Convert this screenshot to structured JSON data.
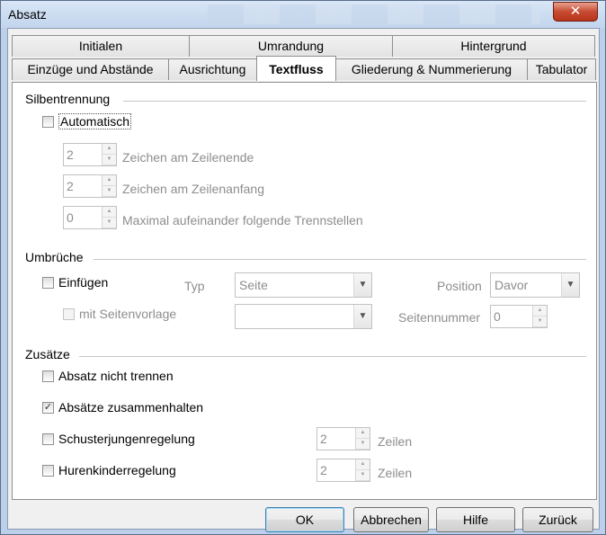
{
  "window": {
    "title": "Absatz",
    "close_glyph": "✕"
  },
  "tabs": {
    "row_top": [
      "Initialen",
      "Umrandung",
      "Hintergrund"
    ],
    "row_bottom": [
      "Einzüge und Abstände",
      "Ausrichtung",
      "Textfluss",
      "Gliederung & Nummerierung",
      "Tabulator"
    ],
    "active": "Textfluss"
  },
  "hyphenation": {
    "heading": "Silbentrennung",
    "automatic_label": "Automatisch",
    "automatic_checked": false,
    "chars_end_value": "2",
    "chars_end_label": "Zeichen am Zeilenende",
    "chars_start_value": "2",
    "chars_start_label": "Zeichen am Zeilenanfang",
    "max_hyphens_value": "0",
    "max_hyphens_label": "Maximal aufeinander folgende Trennstellen"
  },
  "breaks": {
    "heading": "Umbrüche",
    "insert_label": "Einfügen",
    "insert_checked": false,
    "type_label": "Typ",
    "type_value": "Seite",
    "position_label": "Position",
    "position_value": "Davor",
    "with_style_label": "mit Seitenvorlage",
    "with_style_value": "",
    "page_number_label": "Seitennummer",
    "page_number_value": "0"
  },
  "options": {
    "heading": "Zusätze",
    "keep_together_label": "Absatz nicht trennen",
    "keep_together_checked": false,
    "keep_with_next_label": "Absätze zusammenhalten",
    "keep_with_next_checked": true,
    "orphan_label": "Schusterjungenregelung",
    "orphan_checked": false,
    "orphan_value": "2",
    "orphan_unit": "Zeilen",
    "widow_label": "Hurenkinderregelung",
    "widow_checked": false,
    "widow_value": "2",
    "widow_unit": "Zeilen"
  },
  "buttons": {
    "ok": "OK",
    "cancel": "Abbrechen",
    "help": "Hilfe",
    "reset": "Zurück"
  },
  "glyphs": {
    "check": "✓",
    "spin_up": "▲",
    "spin_down": "▼",
    "dropdown": "▼"
  }
}
